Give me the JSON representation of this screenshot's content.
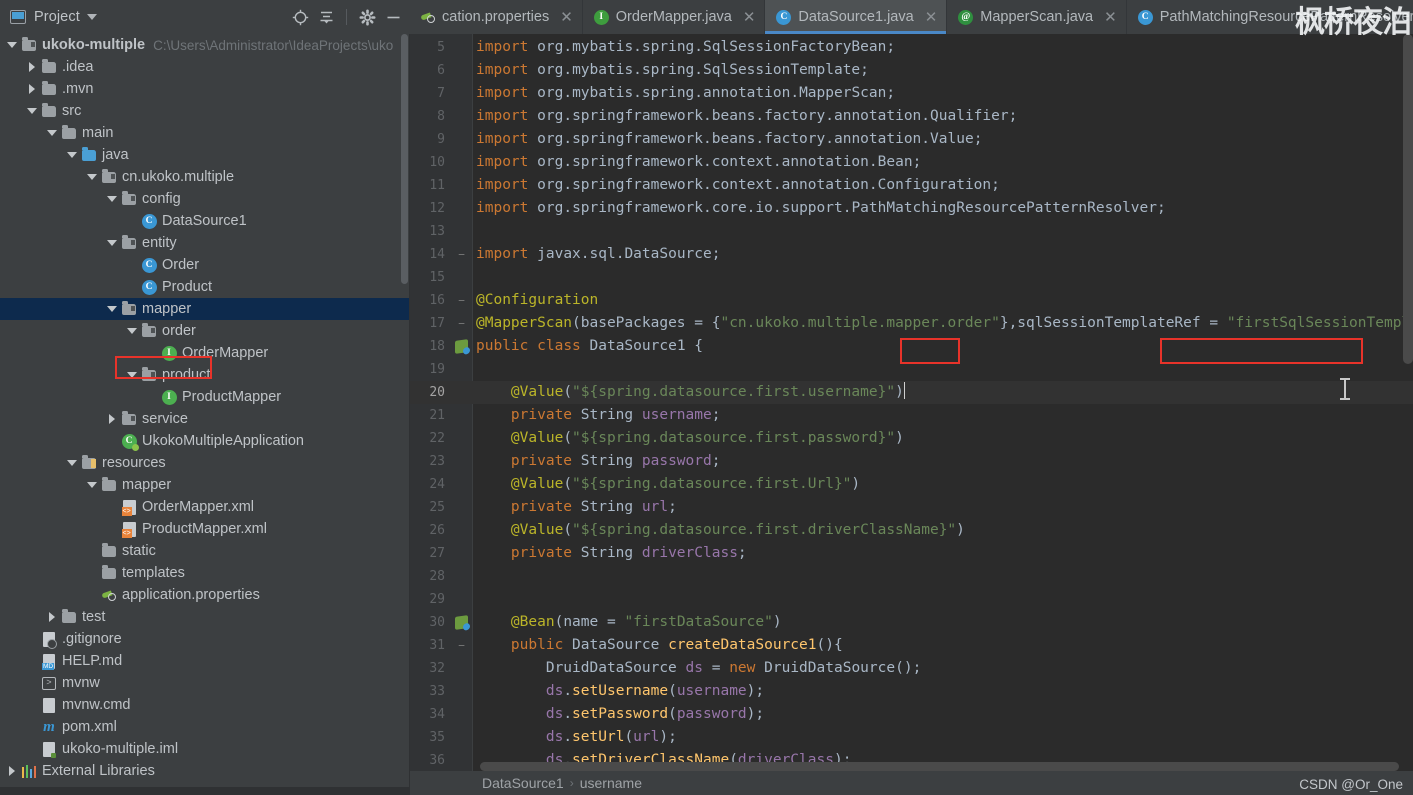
{
  "window": {
    "project_panel_title": "Project",
    "watermark_cn": "枫桥夜泊",
    "watermark_csdn": "CSDN @Or_One"
  },
  "toolbar": {
    "icons": [
      {
        "name": "locate-icon",
        "glyph": "⊕"
      },
      {
        "name": "collapse-all-icon",
        "glyph": "⋜"
      },
      {
        "name": "settings-gear-icon",
        "glyph": "⚙"
      },
      {
        "name": "hide-panel-icon",
        "glyph": "—"
      }
    ]
  },
  "tabs": [
    {
      "label": "cation.properties",
      "icon": "properties-file-icon",
      "icon_kind": "props",
      "active": false,
      "closable": true
    },
    {
      "label": "OrderMapper.java",
      "icon": "java-interface-icon",
      "icon_kind": "iface",
      "icon_letter": "I",
      "active": false,
      "closable": true
    },
    {
      "label": "DataSource1.java",
      "icon": "java-class-icon",
      "icon_kind": "cls",
      "icon_letter": "C",
      "active": true,
      "closable": true
    },
    {
      "label": "MapperScan.java",
      "icon": "java-annotation-icon",
      "icon_kind": "anno",
      "icon_letter": "@",
      "active": false,
      "closable": true
    },
    {
      "label": "PathMatchingResourcePatternResolver.java",
      "icon": "java-class-icon",
      "icon_kind": "cls",
      "icon_letter": "C",
      "active": false,
      "closable": false
    }
  ],
  "tree": {
    "root": {
      "label": "ukoko-multiple",
      "path_hint": "C:\\Users\\Administrator\\IdeaProjects\\uko"
    },
    "items": [
      {
        "label": ".idea",
        "depth": 1,
        "arrow": "right",
        "icon": "folder",
        "selected": false
      },
      {
        "label": ".mvn",
        "depth": 1,
        "arrow": "right",
        "icon": "folder",
        "selected": false
      },
      {
        "label": "src",
        "depth": 1,
        "arrow": "down",
        "icon": "folder",
        "selected": false
      },
      {
        "label": "main",
        "depth": 2,
        "arrow": "down",
        "icon": "folder",
        "selected": false
      },
      {
        "label": "java",
        "depth": 3,
        "arrow": "down",
        "icon": "folder-blue",
        "selected": false
      },
      {
        "label": "cn.ukoko.multiple",
        "depth": 4,
        "arrow": "down",
        "icon": "package",
        "selected": false
      },
      {
        "label": "config",
        "depth": 5,
        "arrow": "down",
        "icon": "package",
        "selected": false
      },
      {
        "label": "DataSource1",
        "depth": 6,
        "arrow": "none",
        "icon": "class",
        "selected": false
      },
      {
        "label": "entity",
        "depth": 5,
        "arrow": "down",
        "icon": "package",
        "selected": false
      },
      {
        "label": "Order",
        "depth": 6,
        "arrow": "none",
        "icon": "class",
        "selected": false
      },
      {
        "label": "Product",
        "depth": 6,
        "arrow": "none",
        "icon": "class",
        "selected": false
      },
      {
        "label": "mapper",
        "depth": 5,
        "arrow": "down",
        "icon": "package",
        "selected": true
      },
      {
        "label": "order",
        "depth": 6,
        "arrow": "down",
        "icon": "package",
        "selected": false,
        "annotated": true
      },
      {
        "label": "OrderMapper",
        "depth": 7,
        "arrow": "none",
        "icon": "interface",
        "selected": false
      },
      {
        "label": "product",
        "depth": 6,
        "arrow": "down",
        "icon": "package",
        "selected": false
      },
      {
        "label": "ProductMapper",
        "depth": 7,
        "arrow": "none",
        "icon": "interface",
        "selected": false
      },
      {
        "label": "service",
        "depth": 5,
        "arrow": "right",
        "icon": "package",
        "selected": false
      },
      {
        "label": "UkokoMultipleApplication",
        "depth": 5,
        "arrow": "none",
        "icon": "spring-class",
        "selected": false
      },
      {
        "label": "resources",
        "depth": 3,
        "arrow": "down",
        "icon": "folder-res",
        "selected": false
      },
      {
        "label": "mapper",
        "depth": 4,
        "arrow": "down",
        "icon": "folder",
        "selected": false
      },
      {
        "label": "OrderMapper.xml",
        "depth": 5,
        "arrow": "none",
        "icon": "xml",
        "selected": false
      },
      {
        "label": "ProductMapper.xml",
        "depth": 5,
        "arrow": "none",
        "icon": "xml",
        "selected": false
      },
      {
        "label": "static",
        "depth": 4,
        "arrow": "none",
        "icon": "folder",
        "selected": false
      },
      {
        "label": "templates",
        "depth": 4,
        "arrow": "none",
        "icon": "folder",
        "selected": false
      },
      {
        "label": "application.properties",
        "depth": 4,
        "arrow": "none",
        "icon": "properties",
        "selected": false
      },
      {
        "label": "test",
        "depth": 2,
        "arrow": "right",
        "icon": "folder",
        "selected": false
      },
      {
        "label": ".gitignore",
        "depth": 1,
        "arrow": "none",
        "icon": "gitignore",
        "selected": false
      },
      {
        "label": "HELP.md",
        "depth": 1,
        "arrow": "none",
        "icon": "markdown",
        "selected": false
      },
      {
        "label": "mvnw",
        "depth": 1,
        "arrow": "none",
        "icon": "shell",
        "selected": false
      },
      {
        "label": "mvnw.cmd",
        "depth": 1,
        "arrow": "none",
        "icon": "file",
        "selected": false
      },
      {
        "label": "pom.xml",
        "depth": 1,
        "arrow": "none",
        "icon": "maven",
        "selected": false
      },
      {
        "label": "ukoko-multiple.iml",
        "depth": 1,
        "arrow": "none",
        "icon": "iml",
        "selected": false
      },
      {
        "label": "External Libraries",
        "depth": 0,
        "arrow": "right",
        "icon": "libraries",
        "selected": false
      }
    ]
  },
  "editor": {
    "file": "DataSource1.java",
    "breadcrumb": [
      "DataSource1",
      "username"
    ],
    "first_visible_line": 5,
    "lines": [
      {
        "n": "5",
        "text": "import org.mybatis.spring.SqlSessionFactoryBean;"
      },
      {
        "n": "6",
        "text": "import org.mybatis.spring.SqlSessionTemplate;"
      },
      {
        "n": "7",
        "text": "import org.mybatis.spring.annotation.MapperScan;"
      },
      {
        "n": "8",
        "text": "import org.springframework.beans.factory.annotation.Qualifier;"
      },
      {
        "n": "9",
        "text": "import org.springframework.beans.factory.annotation.Value;"
      },
      {
        "n": "10",
        "text": "import org.springframework.context.annotation.Bean;"
      },
      {
        "n": "11",
        "text": "import org.springframework.context.annotation.Configuration;"
      },
      {
        "n": "12",
        "text": "import org.springframework.core.io.support.PathMatchingResourcePatternResolver;"
      },
      {
        "n": "13",
        "text": ""
      },
      {
        "n": "14",
        "text": "import javax.sql.DataSource;"
      },
      {
        "n": "15",
        "text": ""
      },
      {
        "n": "16",
        "text": "@Configuration"
      },
      {
        "n": "17",
        "text": "@MapperScan(basePackages = {\"cn.ukoko.multiple.mapper.order\"},sqlSessionTemplateRef = \"firstSqlSessionTemplate\")"
      },
      {
        "n": "18",
        "text": "public class DataSource1 {"
      },
      {
        "n": "19",
        "text": ""
      },
      {
        "n": "20",
        "text": "    @Value(\"${spring.datasource.first.username}\")"
      },
      {
        "n": "21",
        "text": "    private String username;"
      },
      {
        "n": "22",
        "text": "    @Value(\"${spring.datasource.first.password}\")"
      },
      {
        "n": "23",
        "text": "    private String password;"
      },
      {
        "n": "24",
        "text": "    @Value(\"${spring.datasource.first.Url}\")"
      },
      {
        "n": "25",
        "text": "    private String url;"
      },
      {
        "n": "26",
        "text": "    @Value(\"${spring.datasource.first.driverClassName}\")"
      },
      {
        "n": "27",
        "text": "    private String driverClass;"
      },
      {
        "n": "28",
        "text": ""
      },
      {
        "n": "29",
        "text": ""
      },
      {
        "n": "30",
        "text": "    @Bean(name = \"firstDataSource\")"
      },
      {
        "n": "31",
        "text": "    public DataSource createDataSource1(){"
      },
      {
        "n": "32",
        "text": "        DruidDataSource ds = new DruidDataSource();"
      },
      {
        "n": "33",
        "text": "        ds.setUsername(username);"
      },
      {
        "n": "34",
        "text": "        ds.setPassword(password);"
      },
      {
        "n": "35",
        "text": "        ds.setUrl(url);"
      },
      {
        "n": "36",
        "text": "        ds.setDriverClassName(driverClass);"
      }
    ]
  },
  "annotations": {
    "color": "#e8332a",
    "boxes": [
      {
        "name": "order-package-highlight",
        "target": "tree order folder"
      },
      {
        "name": "mapper-order-string-highlight",
        "target": "code .order literal"
      },
      {
        "name": "sql-session-template-ref-highlight",
        "target": "code firstSqlSessionTemplate literal"
      }
    ]
  }
}
